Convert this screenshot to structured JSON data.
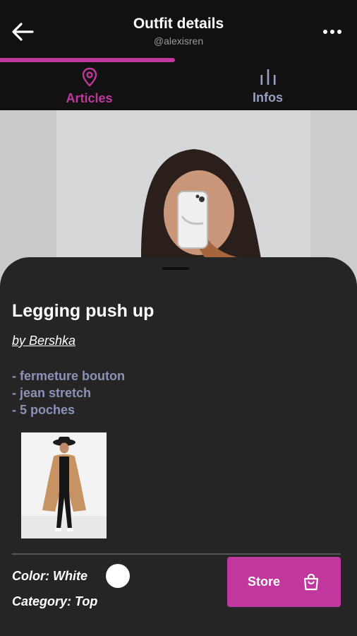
{
  "header": {
    "title": "Outfit details",
    "username": "@alexisren",
    "progress_fraction": 0.49
  },
  "tabs": [
    {
      "label": "Articles",
      "icon": "location-pin-icon",
      "active": true
    },
    {
      "label": "Infos",
      "icon": "bar-chart-icon",
      "active": false
    }
  ],
  "item": {
    "title": "Legging push up",
    "brand": "by Bershka",
    "features": [
      "- fermeture bouton",
      "- jean stretch",
      "- 5 poches"
    ],
    "color_label": "Color: White",
    "color_swatch": "#ffffff",
    "category_label": "Category: Top"
  },
  "store_button": {
    "label": "Store",
    "icon": "shopping-bag-icon"
  },
  "colors": {
    "accent": "#c0379e",
    "background": "#111111",
    "sheet": "#252525",
    "inactive_tab": "#9a9fc3"
  }
}
